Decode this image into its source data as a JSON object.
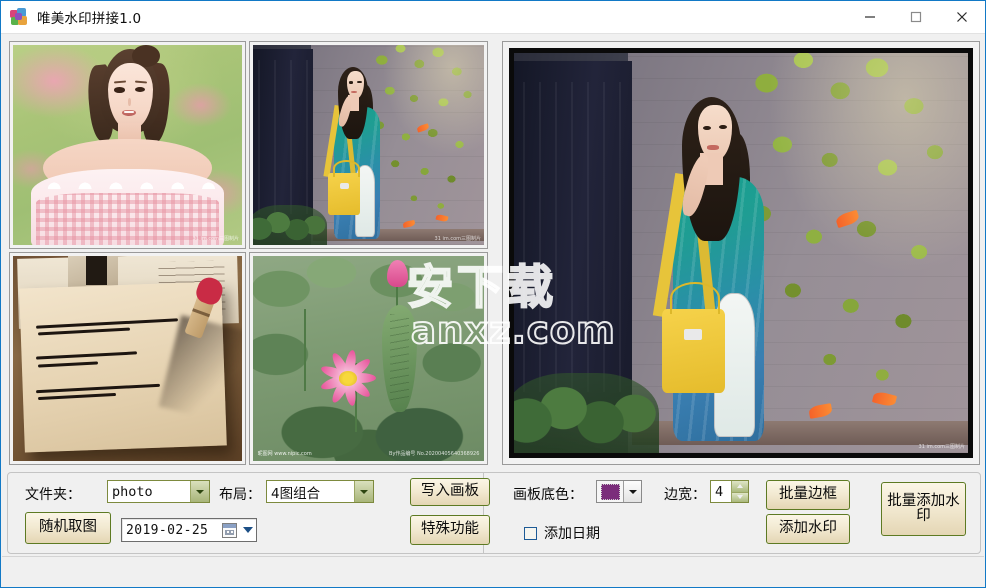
{
  "window": {
    "title": "唯美水印拼接1.0",
    "app_icon": "app-logo-icon",
    "minimize_label": "—",
    "maximize_label": "□",
    "close_label": "✕"
  },
  "thumbnails": [
    {
      "name": "thumbnail-1",
      "caption": ""
    },
    {
      "name": "thumbnail-2",
      "caption": ""
    },
    {
      "name": "thumbnail-3",
      "caption": ""
    },
    {
      "name": "thumbnail-4",
      "caption": ""
    }
  ],
  "thumb_tags": {
    "lotus_left": "昵图网 www.nipic.com",
    "lotus_right": "By作品编号 No.20200405640368926",
    "preview_corner": "31 im.com三图制片"
  },
  "preview": {
    "name": "canvas-preview",
    "border_color": "#000000"
  },
  "watermark": {
    "cjk": "安下载",
    "url": "anxz.com"
  },
  "controls_left": {
    "folder_label": "文件夹：",
    "folder_value": "photo",
    "layout_label": "布局：",
    "layout_value": "4图组合",
    "random_button": "随机取图",
    "date_value": "2019-02-25",
    "write_canvas_button": "写入画板",
    "special_function_button": "特殊功能"
  },
  "controls_right": {
    "bgcolor_label": "画板底色：",
    "bgcolor_value": "#7B2D7B",
    "border_width_label": "边宽：",
    "border_width_value": "4",
    "add_date_label": "添加日期",
    "add_date_checked": false,
    "batch_border_button": "批量边框",
    "add_watermark_button": "添加水印",
    "batch_watermark_button": "批量添加水印"
  },
  "statusbar": {
    "text": ""
  }
}
